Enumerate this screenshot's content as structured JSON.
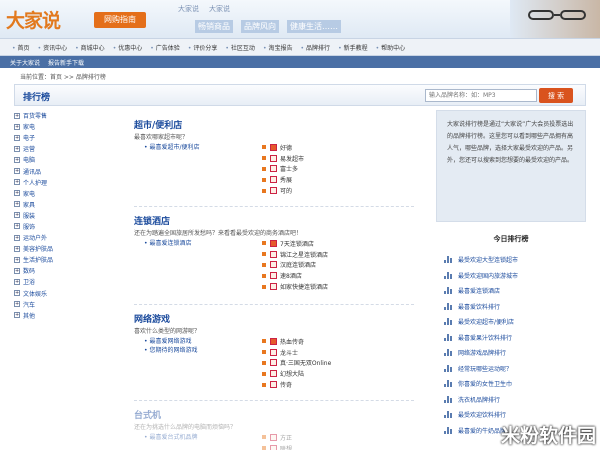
{
  "header": {
    "logo": "大家说",
    "logo_sub": "网购指南",
    "top_links": [
      "大家说",
      "大家说"
    ],
    "slogans": [
      "畅销商品",
      "品牌风向",
      "健康生活……"
    ]
  },
  "nav": [
    "首页",
    "资讯中心",
    "商城中心",
    "优惠中心",
    "广告体验",
    "评价分享",
    "社区互动",
    "淘宝报告",
    "品牌排行",
    "新手教程",
    "帮助中心"
  ],
  "subnav": [
    "关于大家说",
    "报告新手下载"
  ],
  "breadcrumb": "当前位置：首页 >> 品牌排行榜",
  "rank": {
    "title": "排行榜",
    "search_placeholder": "输入品牌名称：如：MP3",
    "search_button": "搜 索"
  },
  "sidebar": [
    "百货零售",
    "家电",
    "电子",
    "运营",
    "电脑",
    "通讯品",
    "个人护理",
    "家电",
    "家具",
    "服装",
    "服饰",
    "运动户外",
    "美容护肤品",
    "生活护肤品",
    "数码",
    "卫浴",
    "文体娱乐",
    "汽车",
    "其他"
  ],
  "sections": [
    {
      "title": "超市/便利店",
      "desc": "最喜欢哪家超市呢？",
      "links": [
        "最喜爱超市/便利店"
      ],
      "options": [
        "好德",
        "易发超市",
        "富士多",
        "秀展",
        "可的"
      ]
    },
    {
      "title": "连锁酒店",
      "desc": "还在为踏遍全国旅居所发愁吗？来看看最受欢迎的商务酒店吧！",
      "links": [
        "最喜爱连锁酒店"
      ],
      "options": [
        "7天连锁酒店",
        "锦江之星连锁酒店",
        "汉庭连锁酒店",
        "速8酒店",
        "如家快捷连锁酒店"
      ]
    },
    {
      "title": "网络游戏",
      "desc": "喜欢什么类型的网游呢？",
      "links": [
        "最喜爱网络游戏",
        "您期待的网络游戏"
      ],
      "options": [
        "热血传奇",
        "龙斗士",
        "真·三国无双Online",
        "幻想大陆",
        "传奇"
      ]
    },
    {
      "title": "台式机",
      "desc": "还在为挑选什么品牌的电脑而烦恼吗？",
      "links": [
        "最喜爱台式机品牌"
      ],
      "options": [
        "方正",
        "联想"
      ]
    }
  ],
  "right": {
    "intro": "大家说排行榜是通过“大家说”广大会员投票选出的品牌排行榜。这里您可以看到哪些产品拥有高人气，哪些品牌，选择大家最受欢迎的产品。另外，您还可以搜索到您想要的最受欢迎的产品。",
    "today_title": "今日排行榜",
    "today_items": [
      "最受欢迎大型连锁超市",
      "最受欢迎国内旅游城市",
      "最喜爱连锁酒店",
      "最喜爱饮料排行",
      "最受欢迎超市/便利店",
      "最喜爱果汁饮料排行",
      "网络游戏品牌排行",
      "经常玩哪些运动呢？",
      "你喜爱的女性卫生巾",
      "洗衣机品牌排行",
      "最受欢迎饮料排行",
      "最喜爱的牛奶品牌"
    ]
  },
  "watermark": "米粉软件园"
}
